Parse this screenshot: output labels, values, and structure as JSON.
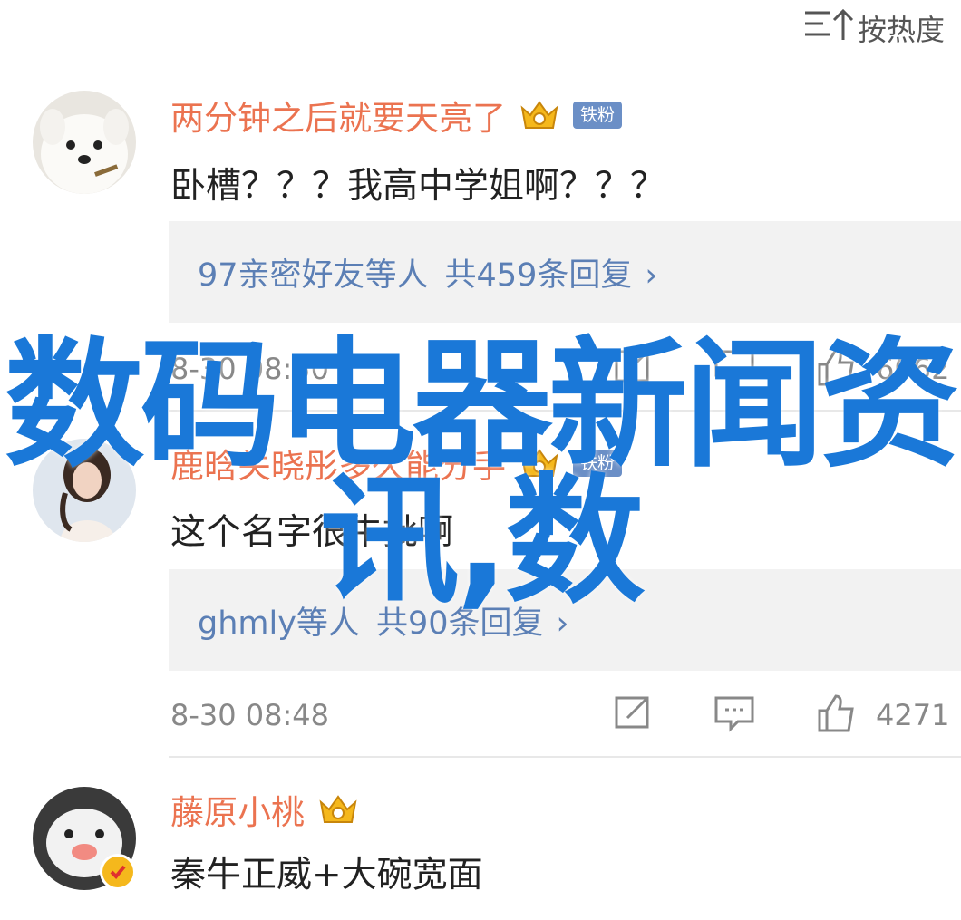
{
  "sort": {
    "label": "按热度",
    "icon": "sort-icon"
  },
  "comments": [
    {
      "name": "两分钟之后就要天亮了",
      "badge": "铁粉",
      "text": "卧槽？？？我高中学姐啊？？？",
      "replies": {
        "users": "97亲密好友等人",
        "count": "共459条回复",
        "chevron": "›"
      },
      "time": "8-30 08:50",
      "likes": "6062"
    },
    {
      "name": "鹿晗关晓彤多久能分手",
      "badge": "铁粉",
      "text": "这个名字很牛批啊",
      "replies": {
        "users": "ghmly等人",
        "count": "共90条回复",
        "chevron": "›"
      },
      "time": "8-30 08:48",
      "likes": "4271"
    },
    {
      "name": "藤原小桃",
      "text": "秦牛正威+大碗宽面"
    }
  ],
  "overlay": {
    "line1": "数码电器新闻资",
    "line2": "讯,数"
  },
  "colors": {
    "username": "#eb7350",
    "link": "#5b7fb5",
    "overlay": "#1a78d8",
    "badge": "#6b8fc6"
  }
}
